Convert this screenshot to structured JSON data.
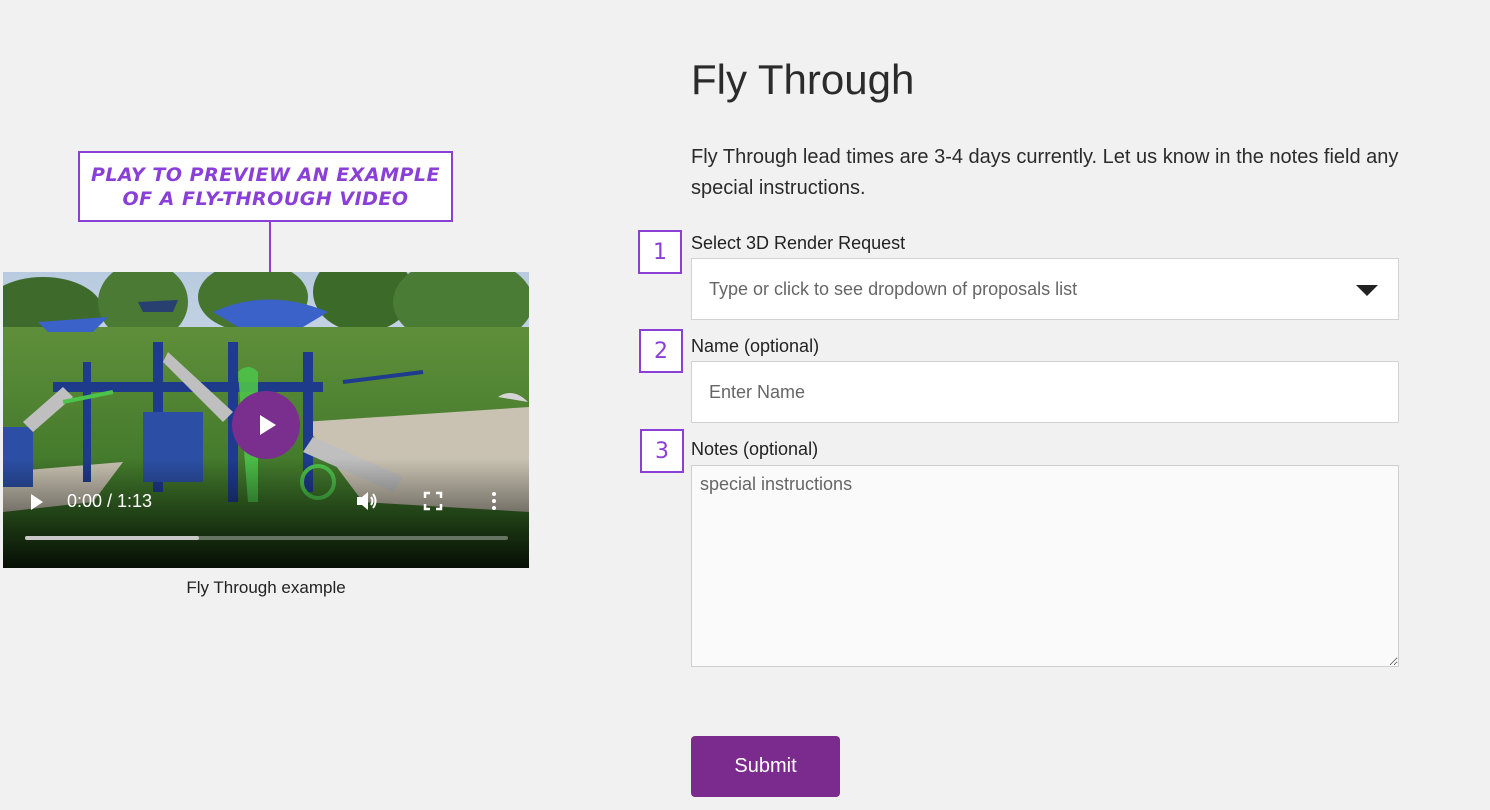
{
  "callout": {
    "text": "Play to preview an example of a fly-through video"
  },
  "video": {
    "time_display": "0:00 / 1:13",
    "progress_buffered_fraction": 0.36,
    "icons": {
      "big_play": "play-circle-icon",
      "play": "play-icon",
      "volume": "volume-icon",
      "fullscreen": "fullscreen-icon",
      "more": "more-vertical-icon"
    },
    "accent_color": "#7a2f8f",
    "caption": "Fly Through example"
  },
  "form": {
    "title": "Fly Through",
    "intro": "Fly Through lead times are 3-4 days currently. Let us know in the notes field any special instructions.",
    "steps": [
      "1",
      "2",
      "3"
    ],
    "render_request": {
      "label": "Select 3D Render Request",
      "placeholder": "Type or click to see dropdown of proposals list",
      "value": ""
    },
    "name": {
      "label": "Name (optional)",
      "placeholder": "Enter Name",
      "value": ""
    },
    "notes": {
      "label": "Notes (optional)",
      "placeholder": "special instructions",
      "value": ""
    },
    "submit_label": "Submit",
    "button_color": "#7b2b8e",
    "annotation_color": "#8a3fd6"
  }
}
